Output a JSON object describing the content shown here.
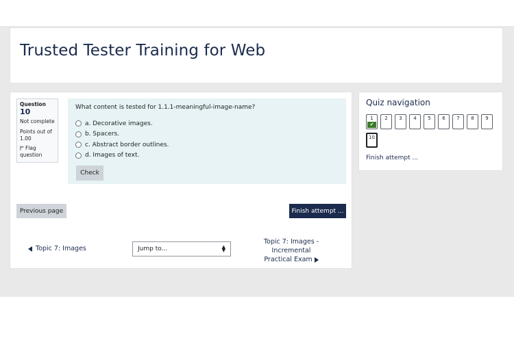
{
  "header": {
    "title": "Trusted Tester Training for Web"
  },
  "question_info": {
    "label": "Question",
    "number": "10",
    "state": "Not complete",
    "grade_line1": "Points out of",
    "grade_line2": "1.00",
    "flag_line1": "Flag",
    "flag_line2": "question",
    "flag_icon": "flag-icon"
  },
  "question": {
    "text": "What content is tested for 1.1.1-meaningful-image-name?",
    "answers": [
      {
        "label": "a. Decorative images.",
        "selected": false
      },
      {
        "label": "b. Spacers.",
        "selected": false
      },
      {
        "label": "c. Abstract border outlines.",
        "selected": false
      },
      {
        "label": "d. Images of text.",
        "selected": false
      }
    ],
    "check_label": "Check"
  },
  "page_nav": {
    "previous_label": "Previous page",
    "finish_label": "Finish attempt ..."
  },
  "activity_nav": {
    "prev_activity": "Topic 7: Images",
    "jump_placeholder": "Jump to...",
    "next_line1": "Topic 7: Images - Incremental",
    "next_line2": "Practical Exam"
  },
  "quiz_nav": {
    "title": "Quiz navigation",
    "buttons": [
      {
        "label": "1",
        "answered": true
      },
      {
        "label": "2"
      },
      {
        "label": "3"
      },
      {
        "label": "4"
      },
      {
        "label": "5"
      },
      {
        "label": "6"
      },
      {
        "label": "7"
      },
      {
        "label": "8"
      },
      {
        "label": "9"
      },
      {
        "label": "10",
        "current": true
      }
    ],
    "finish_link": "Finish attempt ..."
  },
  "colors": {
    "accent": "#1b2b4d",
    "answered": "#3a7c2b",
    "question_bg": "#e7f3f4"
  }
}
